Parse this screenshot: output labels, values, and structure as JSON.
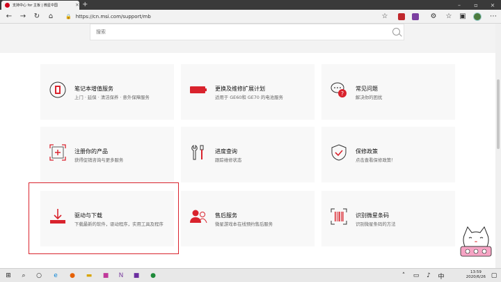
{
  "browser": {
    "tab_title": "支持中心 for 主板 | 微星中国",
    "url": "https://cn.msi.com/support/mb"
  },
  "search": {
    "placeholder": "搜索"
  },
  "cards": [
    {
      "title": "笔记本增值服务",
      "desc": "上门 · 延保 · 清洁保养 · 意外保障服务",
      "icon": "laptop-service-icon"
    },
    {
      "title": "更换及维修扩展计划",
      "desc": "适用于 GE60和 GE70 的电池服务",
      "icon": "battery-icon"
    },
    {
      "title": "常见问题",
      "desc": "解决你的困扰",
      "icon": "faq-icon"
    },
    {
      "title": "注册你的产品",
      "desc": "获得促销咨询与更多服务",
      "icon": "register-product-icon"
    },
    {
      "title": "进度查询",
      "desc": "跟踪维修状态",
      "icon": "repair-tools-icon"
    },
    {
      "title": "保修政策",
      "desc": "点击查看保修政策！",
      "icon": "warranty-shield-icon"
    },
    {
      "title": "驱动与下载",
      "desc": "下载最新的软件，驱动程序，实用工具及程序",
      "icon": "download-icon"
    },
    {
      "title": "售后服务",
      "desc": "微星游戏本在线预约售后服务",
      "icon": "after-sales-icon"
    },
    {
      "title": "识别微星条码",
      "desc": "识别微星条码的方法",
      "icon": "barcode-icon"
    }
  ],
  "clock": {
    "time": "13:59",
    "date": "2020/6/26"
  },
  "colors": {
    "accent": "#d9232d"
  }
}
